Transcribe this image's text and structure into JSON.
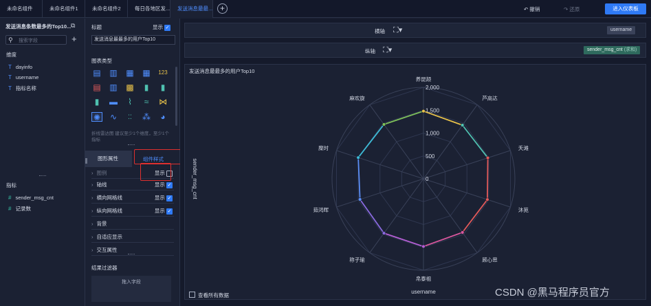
{
  "tabs": [
    "未命名组件",
    "未命名组件1",
    "未命名组件2",
    "每日各地区发...",
    "发送消息最最..."
  ],
  "active_tab": 4,
  "toolbar": {
    "undo": "撤销",
    "redo": "还原",
    "enter_dashboard": "进入仪表板"
  },
  "left_panel": {
    "title": "发送消息条数最多的Top10...",
    "search_placeholder": "搜索字段",
    "dimensions_label": "维度",
    "dimensions": [
      "dayinfo",
      "username",
      "指标名称"
    ],
    "metrics_label": "指标",
    "metrics": [
      "sender_msg_cnt",
      "记录数"
    ]
  },
  "mid_panel": {
    "title_label": "标题",
    "show_label": "显示",
    "title_value": "发送消息最最多的用户Top10",
    "chart_type_label": "图表类型",
    "chart_hint": "折线雷达图 建议至少1个维度，至少1个指标",
    "tab_shape": "图形属性",
    "tab_style": "组件样式",
    "rows": [
      {
        "label": "图例",
        "show": "显示",
        "checked": false
      },
      {
        "label": "轴线",
        "show": "显示",
        "checked": true
      },
      {
        "label": "横向网格线",
        "show": "显示",
        "checked": true
      },
      {
        "label": "纵向网格线",
        "show": "显示",
        "checked": true
      },
      {
        "label": "背景",
        "show": "",
        "checked": null
      },
      {
        "label": "自适应显示",
        "show": "",
        "checked": null
      },
      {
        "label": "交互属性",
        "show": "",
        "checked": null
      }
    ],
    "filter_label": "结果过滤器",
    "drop_field": "拖入字段"
  },
  "canvas": {
    "x_axis_label": "横轴",
    "y_axis_label": "纵轴",
    "x_field": "username",
    "y_field": "sender_msg_cnt",
    "y_field_agg": "(求和)",
    "chart_title": "发送消息最最多的用户Top10",
    "view_all": "查看所有数据"
  },
  "chart_data": {
    "type": "radar",
    "title": "发送消息最最多的用户Top10",
    "xlabel": "username",
    "ylabel": "sender_msg_cnt",
    "ylim": [
      0,
      2000
    ],
    "ticks": [
      0,
      500,
      1000,
      1500,
      2000
    ],
    "categories": [
      "养昆颉",
      "芦高达",
      "夭滩",
      "沐苑",
      "顾心思",
      "帛泰祖",
      "称子瑜",
      "茹鸿晖",
      "糜时",
      "麻欢旋"
    ],
    "values": [
      1480,
      1450,
      1480,
      1470,
      1450,
      1480,
      1470,
      1460,
      1500,
      1470
    ],
    "point_colors": [
      "#e8c24a",
      "#4fc1b0",
      "#e35a5a",
      "#e35a5a",
      "#d8579d",
      "#b65fd6",
      "#8a6ae0",
      "#5b8ef5",
      "#3dbbd6",
      "#7fc25a"
    ],
    "grid": true
  },
  "watermark": "CSDN @黑马程序员官方",
  "colors": {
    "accent": "#2f7af5",
    "highlight_box": "#e0302f"
  }
}
